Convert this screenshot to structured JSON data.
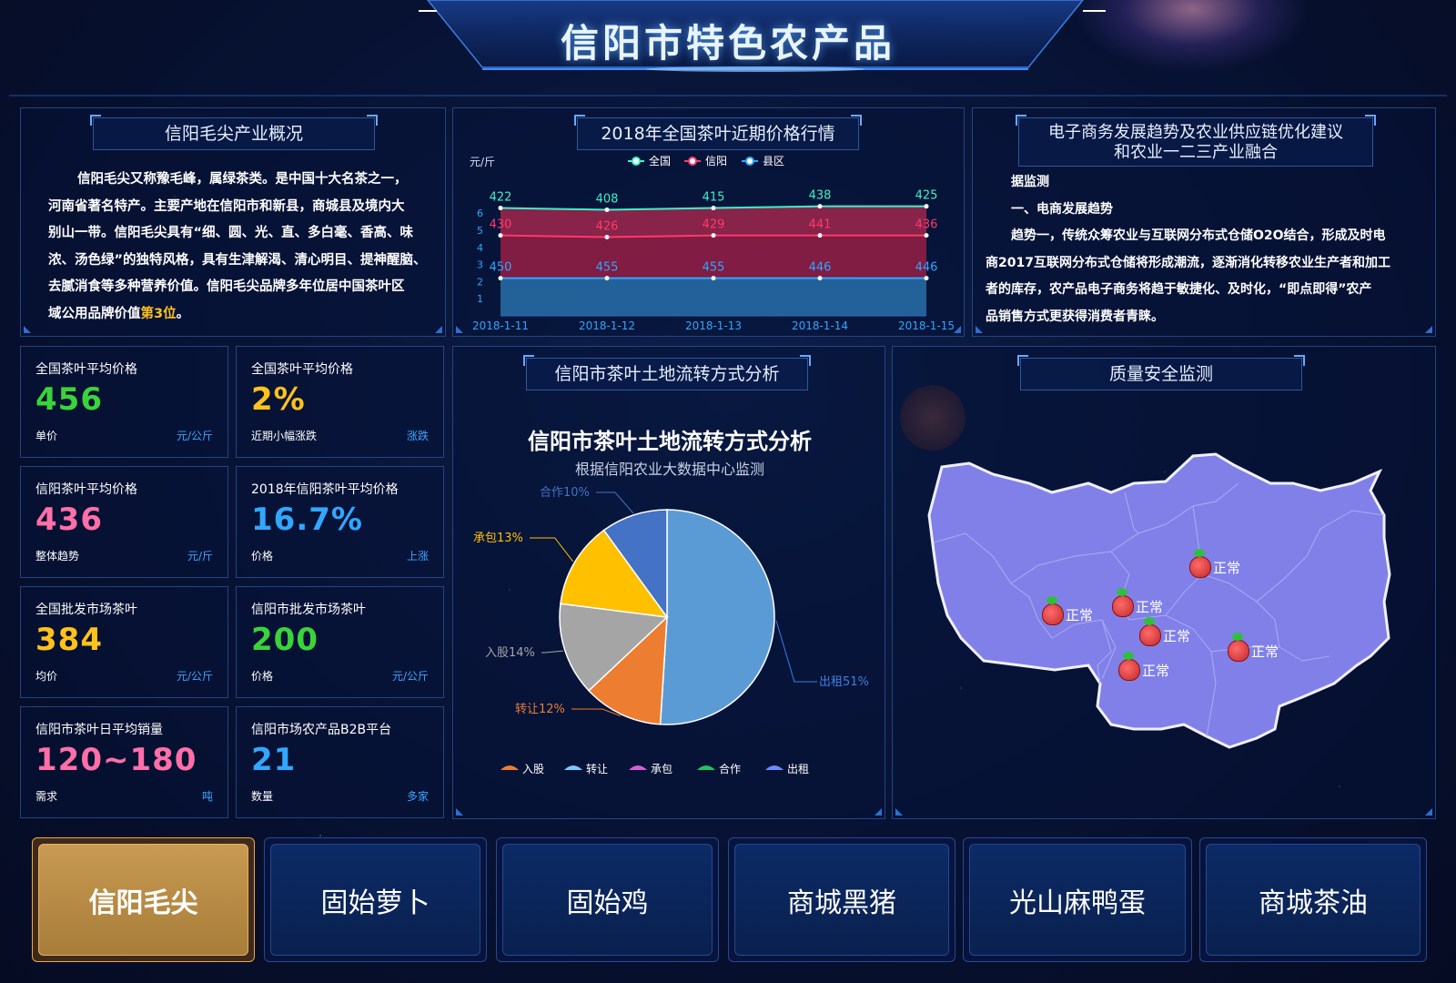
{
  "header": {
    "title": "信阳市特色农产品"
  },
  "overview": {
    "title": "信阳毛尖产业概况",
    "lines": [
      "信阳毛尖又称豫毛峰，属绿茶类。是中国十大名茶之一，",
      "河南省著名特产。主要产地在信阳市和新县，商城县及境内大",
      "别山一带。信阳毛尖具有“细、圆、光、直、多白毫、香高、味",
      "浓、汤色绿”的独特风格，具有生津解渴、清心明目、提神醒脑、",
      "去腻消食等多种营养价值。信阳毛尖品牌多年位居中国茶叶区"
    ],
    "last_line_prefix": "域公用品牌价值",
    "last_line_highlight": "第3位",
    "last_line_suffix": "。"
  },
  "price_chart": {
    "title": "2018年全国茶叶近期价格行情",
    "unit_label": "元/斤"
  },
  "chart_data": [
    {
      "type": "area",
      "title": "2018年全国茶叶近期价格行情",
      "ylabel": "元/斤",
      "categories": [
        "2018-1-11",
        "2018-1-12",
        "2018-1-13",
        "2018-1-14",
        "2018-1-15"
      ],
      "y_ticks": [
        "1",
        "2",
        "3",
        "4",
        "5",
        "6"
      ],
      "ylim": [
        0,
        7
      ],
      "stacked": true,
      "series": [
        {
          "name": "全国",
          "labels": [
            422,
            408,
            415,
            438,
            425
          ],
          "position": [
            6.3,
            6.2,
            6.3,
            6.4,
            6.4
          ],
          "color": "#3ef0c8"
        },
        {
          "name": "信阳",
          "labels": [
            430,
            426,
            429,
            441,
            436
          ],
          "position": [
            4.7,
            4.6,
            4.7,
            4.7,
            4.7
          ],
          "color": "#ff3a6a"
        },
        {
          "name": "县区",
          "labels": [
            450,
            455,
            455,
            446,
            446
          ],
          "position": [
            2.2,
            2.2,
            2.2,
            2.2,
            2.2
          ],
          "color": "#2fa7ff"
        }
      ],
      "legend": "top"
    },
    {
      "type": "pie",
      "title": "信阳市茶叶土地流转方式分析",
      "subtitle": "根据信阳农业大数据中心监测",
      "slices": [
        {
          "name": "出租",
          "value": 51,
          "label": "出租51%",
          "color": "#5b9bd5"
        },
        {
          "name": "转让",
          "value": 12,
          "label": "转让12%",
          "color": "#ed7d31"
        },
        {
          "name": "入股",
          "value": 14,
          "label": "入股14%",
          "color": "#a5a5a5"
        },
        {
          "name": "承包",
          "value": 13,
          "label": "承包13%",
          "color": "#ffc000"
        },
        {
          "name": "合作",
          "value": 10,
          "label": "合作10%",
          "color": "#4472c4"
        }
      ],
      "legend_items": [
        {
          "name": "入股",
          "color": "#ed7d31"
        },
        {
          "name": "转让",
          "color": "#7ec8ff"
        },
        {
          "name": "承包",
          "color": "#d55fd8"
        },
        {
          "name": "合作",
          "color": "#22c35e"
        },
        {
          "name": "出租",
          "color": "#6a8cff"
        }
      ],
      "legend": "bottom"
    }
  ],
  "ecommerce": {
    "title_line1": "电子商务发展趋势及农业供应链优化建议",
    "title_line2": "和农业一二三产业融合",
    "lines": [
      "据监测",
      "一、电商发展趋势",
      "趋势一，传统众筹农业与互联网分布式仓储O2O结合，形成及时电",
      "商2017互联网分布式仓储将形成潮流，逐渐消化转移农业生产者和加工",
      "者的库存，农产品电子商务将趋于敏捷化、及时化，“即点即得”农产",
      "品销售方式更获得消费者青睐。"
    ]
  },
  "stats": [
    {
      "label": "全国茶叶平均价格",
      "value": "456",
      "sub": "单价",
      "unit": "元/公斤",
      "color": "#3ad43a"
    },
    {
      "label": "全国茶叶平均价格",
      "value": "2%",
      "sub": "近期小幅涨跌",
      "unit": "涨跌",
      "color": "#ffc21a"
    },
    {
      "label": "信阳茶叶平均价格",
      "value": "436",
      "sub": "整体趋势",
      "unit": "元/斤",
      "color": "#ff6fa8"
    },
    {
      "label": "2018年信阳茶叶平均价格",
      "value": "16.7%",
      "sub": "价格",
      "unit": "上涨",
      "color": "#31a7ff"
    },
    {
      "label": "全国批发市场茶叶",
      "value": "384",
      "sub": "均价",
      "unit": "元/公斤",
      "color": "#ffc21a"
    },
    {
      "label": "信阳市批发市场茶叶",
      "value": "200",
      "sub": "价格",
      "unit": "元/公斤",
      "color": "#3ad43a"
    },
    {
      "label": "信阳市茶叶日平均销量",
      "value": "120~180",
      "sub": "需求",
      "unit": "吨",
      "color": "#ff6fa8"
    },
    {
      "label": "信阳市场农产品B2B平台",
      "value": "21",
      "sub": "数量",
      "unit": "多家",
      "color": "#31a7ff"
    }
  ],
  "land_panel": {
    "title": "信阳市茶叶土地流转方式分析"
  },
  "quality": {
    "title": "质量安全监测",
    "markers": [
      "正常",
      "正常",
      "正常",
      "正常",
      "正常",
      "正常"
    ]
  },
  "products": [
    "信阳毛尖",
    "固始萝卜",
    "固始鸡",
    "商城黑猪",
    "光山麻鸭蛋",
    "商城茶油"
  ],
  "active_product": "信阳毛尖"
}
